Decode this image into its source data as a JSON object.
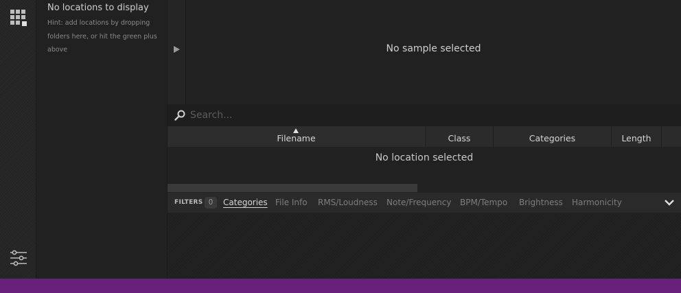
{
  "locations": {
    "title": "No locations to display",
    "hint": "Hint: add locations by dropping folders here, or hit the green plus above"
  },
  "waveform": {
    "empty_text": "No sample selected"
  },
  "search": {
    "placeholder": "Search..."
  },
  "table": {
    "columns": [
      "Filename",
      "Class",
      "Categories",
      "Length",
      ""
    ],
    "sorted_by": "Filename",
    "empty_text": "No location selected"
  },
  "filters": {
    "label": "FILTERS",
    "count": "0",
    "tabs": [
      "Categories",
      "File Info",
      "RMS/Loudness",
      "Note/Frequency",
      "BPM/Tempo",
      "Brightness",
      "Harmonicity"
    ],
    "active_tab": "Categories"
  },
  "colors": {
    "accent_status_bar": "#68217a",
    "background": "#1f1f1f",
    "panel": "#212121",
    "header": "#2b2b2b"
  },
  "icons": [
    "grid-view-icon",
    "settings-sliders-icon",
    "play-icon",
    "search-icon",
    "sort-ascending-icon",
    "chevron-down-icon"
  ]
}
